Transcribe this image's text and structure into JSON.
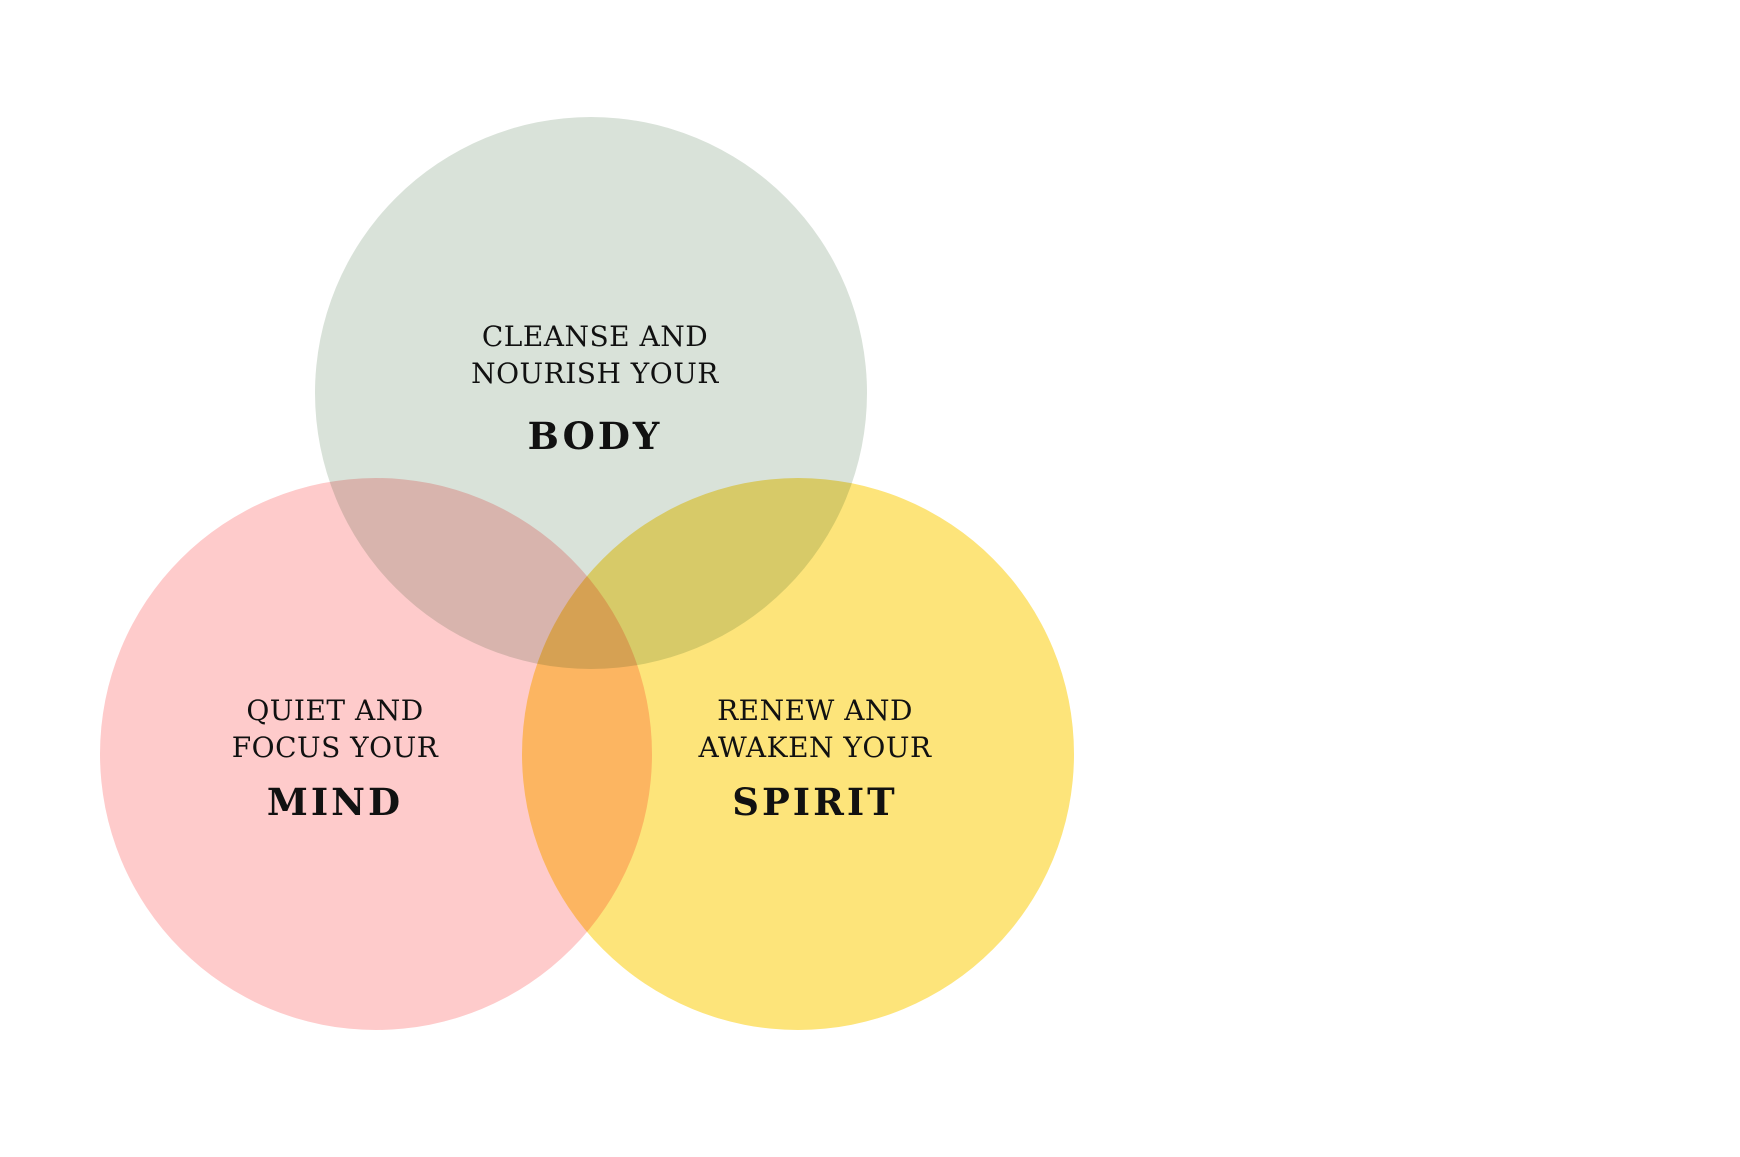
{
  "colors": {
    "body_circle": "#d9e2d9",
    "mind_circle": "#fecbcb",
    "spirit_circle": "#fde47a",
    "background": "#ffffff",
    "text": "#111111"
  },
  "circles": {
    "body": {
      "line1": "CLEANSE AND",
      "line2": "NOURISH YOUR",
      "word": "BODY"
    },
    "mind": {
      "line1": "QUIET AND",
      "line2": "FOCUS YOUR",
      "word": "MIND"
    },
    "spirit": {
      "line1": "RENEW AND",
      "line2": "AWAKEN YOUR",
      "word": "SPIRIT"
    }
  }
}
